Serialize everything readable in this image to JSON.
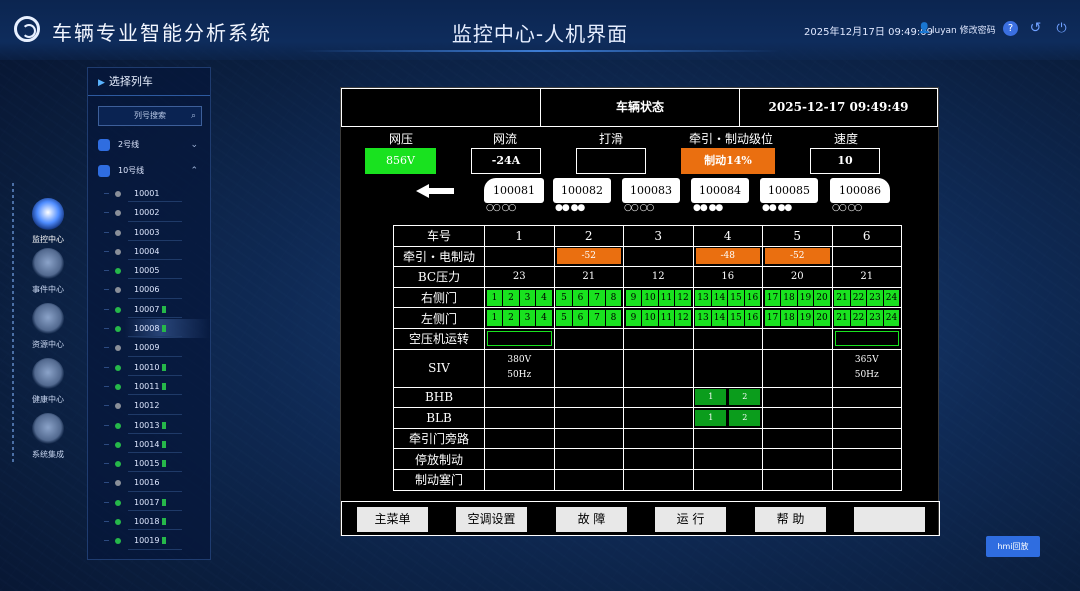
{
  "header": {
    "app_title": "车辆专业智能分析系统",
    "center_title": "监控中心-人机界面",
    "datetime": "2025年12月17日 09:49:09",
    "user": "luyan 修改密码",
    "help": "?",
    "back": "↺",
    "power": "⏻"
  },
  "nav": [
    {
      "label": "监控中心",
      "active": true
    },
    {
      "label": "事件中心"
    },
    {
      "label": "资源中心"
    },
    {
      "label": "健康中心"
    },
    {
      "label": "系统集成"
    }
  ],
  "tree": {
    "title": "选择列车",
    "search_placeholder": "列号搜索",
    "lines": [
      {
        "label": "2号线"
      },
      {
        "label": "10号线"
      }
    ],
    "cars": [
      {
        "id": "10001",
        "online": false,
        "batt": false
      },
      {
        "id": "10002",
        "online": false,
        "batt": false
      },
      {
        "id": "10003",
        "online": false,
        "batt": false
      },
      {
        "id": "10004",
        "online": false,
        "batt": false
      },
      {
        "id": "10005",
        "online": true,
        "batt": false
      },
      {
        "id": "10006",
        "online": false,
        "batt": false
      },
      {
        "id": "10007",
        "online": true,
        "batt": true
      },
      {
        "id": "10008",
        "online": true,
        "batt": true,
        "selected": true
      },
      {
        "id": "10009",
        "online": false,
        "batt": false
      },
      {
        "id": "10010",
        "online": true,
        "batt": true
      },
      {
        "id": "10011",
        "online": true,
        "batt": true
      },
      {
        "id": "10012",
        "online": false,
        "batt": false
      },
      {
        "id": "10013",
        "online": true,
        "batt": true
      },
      {
        "id": "10014",
        "online": true,
        "batt": true
      },
      {
        "id": "10015",
        "online": true,
        "batt": true
      },
      {
        "id": "10016",
        "online": false,
        "batt": false
      },
      {
        "id": "10017",
        "online": true,
        "batt": true
      },
      {
        "id": "10018",
        "online": true,
        "batt": true
      },
      {
        "id": "10019",
        "online": true,
        "batt": true
      }
    ]
  },
  "hmi": {
    "header_cells": [
      "",
      "车辆状态",
      "2025-12-17  09:49:49"
    ],
    "labels": {
      "voltage": "网压",
      "current": "网流",
      "slip": "打滑",
      "level": "牵引・制动级位",
      "speed": "速度"
    },
    "values": {
      "voltage": "856V",
      "current": "-24A",
      "slip": "",
      "level": "制动14%",
      "speed": "10"
    },
    "cars": [
      "100081",
      "100082",
      "100083",
      "100084",
      "100085",
      "100086"
    ],
    "wheels": [
      "○○  ○○",
      "●●  ●●",
      "○○  ○○",
      "●●  ●●",
      "●●  ●●",
      "○○  ○○"
    ],
    "table": {
      "row_labels": [
        "车号",
        "牵引・电制动",
        "BC压力",
        "右侧门",
        "左侧门",
        "空压机运转",
        "SIV",
        "BHB",
        "BLB",
        "牵引门旁路",
        "停放制动",
        "制动塞门"
      ],
      "car_numbers": [
        "1",
        "2",
        "3",
        "4",
        "5",
        "6"
      ],
      "traction": [
        "",
        "-52",
        "",
        "-48",
        "-52",
        ""
      ],
      "bc_pressure": [
        "23",
        "21",
        "12",
        "16",
        "20",
        "21"
      ],
      "doors": [
        "1",
        "2",
        "3",
        "4",
        "5",
        "6",
        "7",
        "8",
        "9",
        "10",
        "11",
        "12",
        "13",
        "14",
        "15",
        "16",
        "17",
        "18",
        "19",
        "20",
        "21",
        "22",
        "23",
        "24"
      ],
      "siv": [
        {
          "v": "380V",
          "f": "50Hz"
        },
        null,
        null,
        null,
        null,
        {
          "v": "365V",
          "f": "50Hz"
        }
      ],
      "bh": [
        "1",
        "2"
      ]
    },
    "buttons": [
      "主菜单",
      "空调设置",
      "故 障",
      "运 行",
      "帮 助",
      ""
    ]
  },
  "hm_button": "hmi回放",
  "colors": {
    "green": "#19e21f",
    "orange": "#ea6f10",
    "accent": "#2f6de0"
  }
}
